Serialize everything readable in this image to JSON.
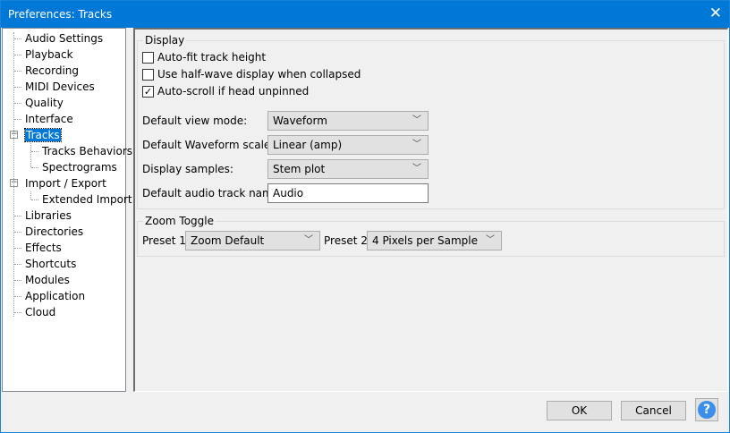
{
  "window": {
    "title": "Preferences: Tracks",
    "close_icon": "close-icon",
    "accent": "#0078d7"
  },
  "tree": {
    "items": [
      {
        "label": "Audio Settings",
        "level": 0
      },
      {
        "label": "Playback",
        "level": 0
      },
      {
        "label": "Recording",
        "level": 0
      },
      {
        "label": "MIDI Devices",
        "level": 0
      },
      {
        "label": "Quality",
        "level": 0
      },
      {
        "label": "Interface",
        "level": 0
      },
      {
        "label": "Tracks",
        "level": 0,
        "selected": true,
        "expanded": true
      },
      {
        "label": "Tracks Behaviors",
        "level": 1
      },
      {
        "label": "Spectrograms",
        "level": 1
      },
      {
        "label": "Import / Export",
        "level": 0,
        "expanded": true
      },
      {
        "label": "Extended Import",
        "level": 1
      },
      {
        "label": "Libraries",
        "level": 0
      },
      {
        "label": "Directories",
        "level": 0
      },
      {
        "label": "Effects",
        "level": 0
      },
      {
        "label": "Shortcuts",
        "level": 0
      },
      {
        "label": "Modules",
        "level": 0
      },
      {
        "label": "Application",
        "level": 0
      },
      {
        "label": "Cloud",
        "level": 0
      }
    ]
  },
  "display": {
    "title": "Display",
    "checkboxes": [
      {
        "label": "Auto-fit track height",
        "checked": false
      },
      {
        "label": "Use half-wave display when collapsed",
        "checked": false
      },
      {
        "label": "Auto-scroll if head unpinned",
        "checked": true
      }
    ],
    "view_mode": {
      "label": "Default view mode:",
      "value": "Waveform"
    },
    "waveform_scale": {
      "label": "Default Waveform scale:",
      "value": "Linear (amp)"
    },
    "display_samples": {
      "label": "Display samples:",
      "value": "Stem plot"
    },
    "track_name": {
      "label": "Default audio track name:",
      "value": "Audio"
    }
  },
  "zoom": {
    "title": "Zoom Toggle",
    "preset1": {
      "label": "Preset 1:",
      "value": "Zoom Default"
    },
    "preset2": {
      "label": "Preset 2:",
      "value": "4 Pixels per Sample"
    }
  },
  "buttons": {
    "ok": "OK",
    "cancel": "Cancel",
    "help": "?"
  }
}
